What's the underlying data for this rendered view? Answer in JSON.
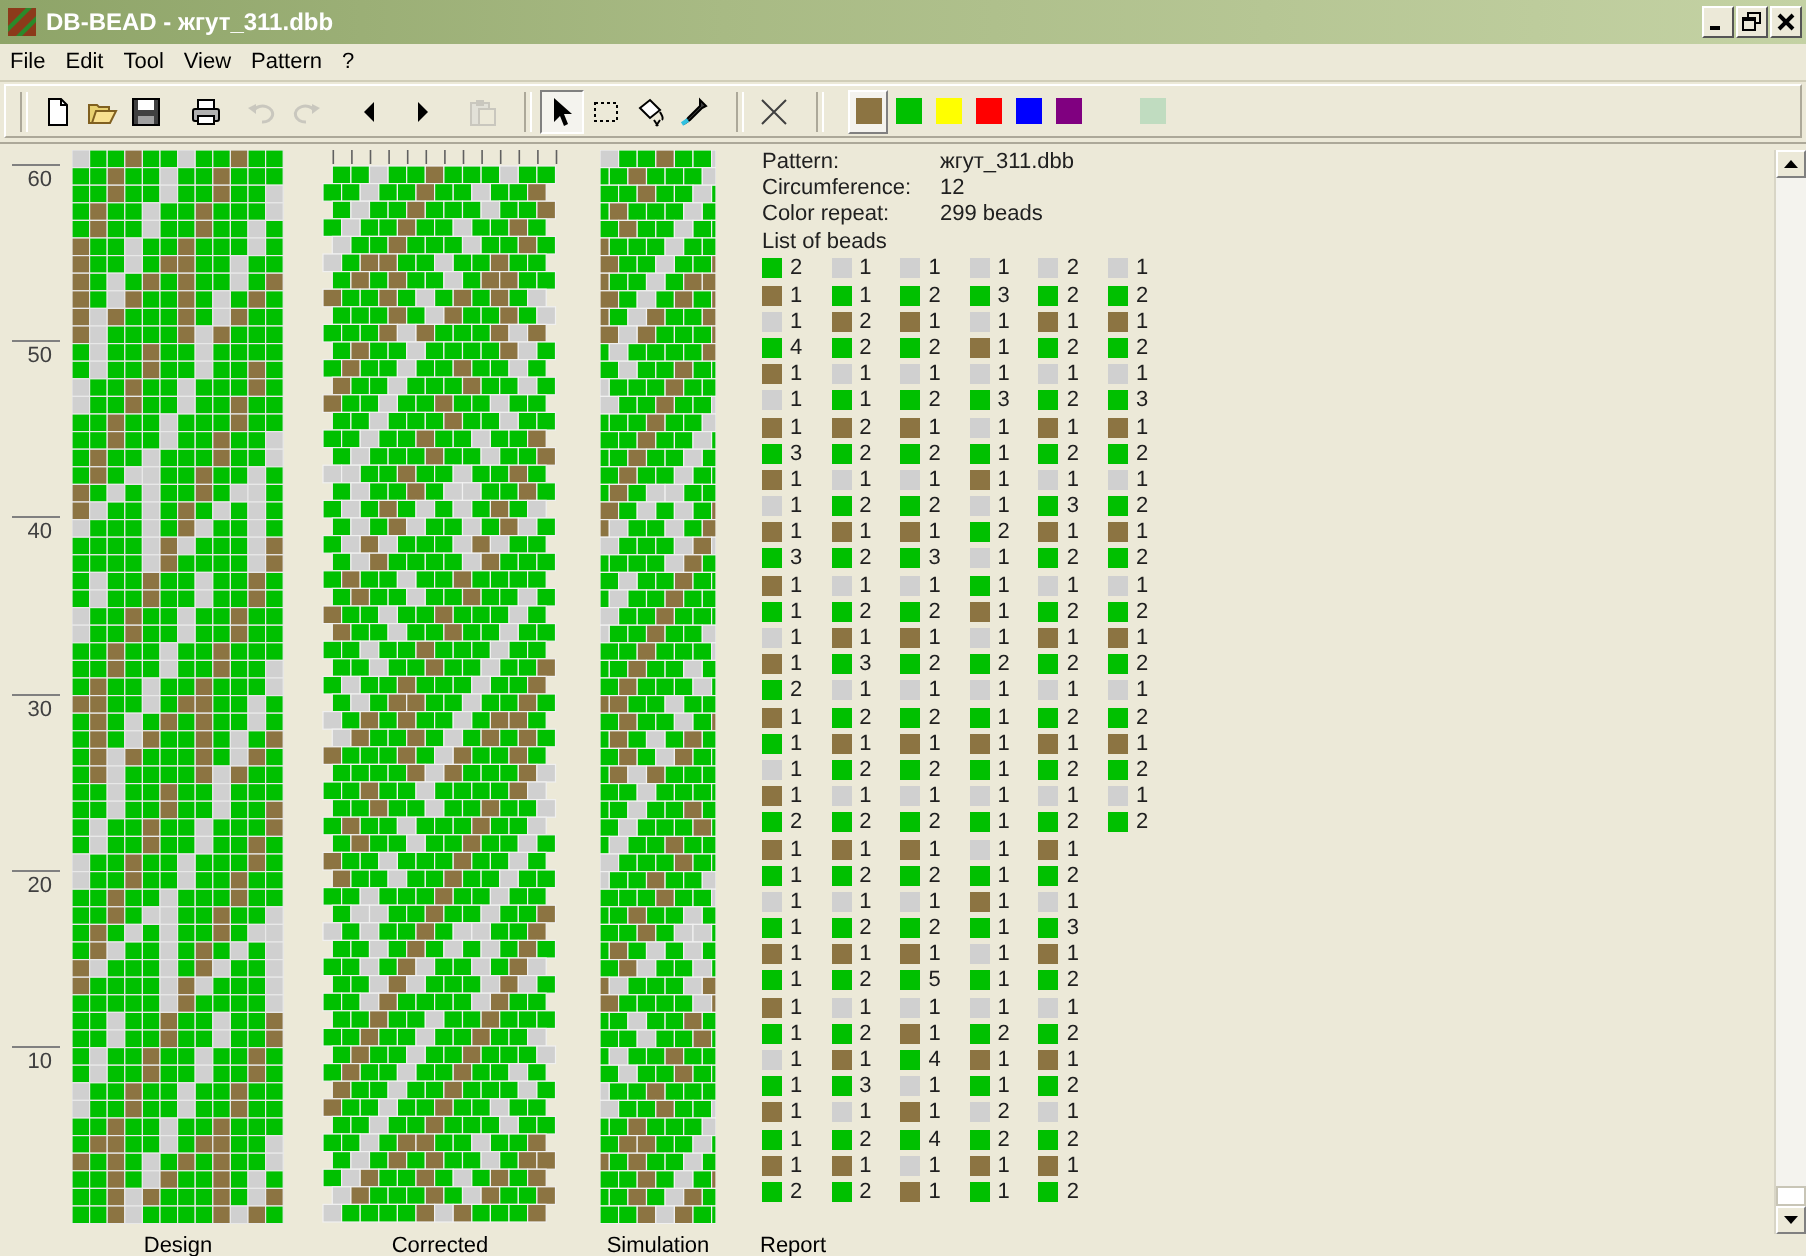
{
  "window": {
    "title": "DB-BEAD - жгут_311.dbb"
  },
  "menu": [
    "File",
    "Edit",
    "Tool",
    "View",
    "Pattern",
    "?"
  ],
  "toolbar": {
    "file_buttons": [
      {
        "kind": "new",
        "disabled": false
      },
      {
        "kind": "open",
        "disabled": false
      },
      {
        "kind": "save",
        "disabled": false
      },
      {
        "kind": "print",
        "disabled": false
      },
      {
        "kind": "undo",
        "disabled": true
      },
      {
        "kind": "redo",
        "disabled": true
      },
      {
        "kind": "prev",
        "disabled": false
      },
      {
        "kind": "next",
        "disabled": false
      },
      {
        "kind": "paste",
        "disabled": true
      }
    ],
    "tools": [
      {
        "kind": "pointer",
        "selected": true
      },
      {
        "kind": "rect",
        "selected": false
      },
      {
        "kind": "fill",
        "selected": false
      },
      {
        "kind": "dropper",
        "selected": false
      }
    ],
    "palette": [
      {
        "color": "#8c7442",
        "selected": true
      },
      {
        "color": "#00c000",
        "selected": false
      },
      {
        "color": "#ffff00",
        "selected": false
      },
      {
        "color": "#ff0000",
        "selected": false
      },
      {
        "color": "#0000ff",
        "selected": false
      },
      {
        "color": "#800080",
        "selected": false
      },
      {
        "color": "#c0dcc0",
        "selected": false
      }
    ]
  },
  "ruler": [
    "60",
    "50",
    "40",
    "30",
    "20",
    "10"
  ],
  "views": [
    "Design",
    "Corrected",
    "Simulation",
    "Report"
  ],
  "report": {
    "info": [
      {
        "label": "Pattern:",
        "value": "жгут_311.dbb"
      },
      {
        "label": "Circumference:",
        "value": "12"
      },
      {
        "label": "Color repeat:",
        "value": "299 beads"
      }
    ],
    "list_title": "List of beads",
    "bead_columns": [
      [
        {
          "color": "#00c000",
          "count": "2"
        },
        {
          "color": "#8c7442",
          "count": "1"
        },
        {
          "color": "#d0d0d0",
          "count": "1"
        },
        {
          "color": "#00c000",
          "count": "4"
        },
        {
          "color": "#8c7442",
          "count": "1"
        },
        {
          "color": "#d0d0d0",
          "count": "1"
        },
        {
          "color": "#8c7442",
          "count": "1"
        },
        {
          "color": "#00c000",
          "count": "3"
        },
        {
          "color": "#8c7442",
          "count": "1"
        },
        {
          "color": "#d0d0d0",
          "count": "1"
        },
        {
          "color": "#8c7442",
          "count": "1"
        },
        {
          "color": "#00c000",
          "count": "3"
        },
        {
          "color": "#8c7442",
          "count": "1"
        },
        {
          "color": "#00c000",
          "count": "1"
        },
        {
          "color": "#d0d0d0",
          "count": "1"
        },
        {
          "color": "#8c7442",
          "count": "1"
        },
        {
          "color": "#00c000",
          "count": "2"
        },
        {
          "color": "#8c7442",
          "count": "1"
        },
        {
          "color": "#00c000",
          "count": "1"
        },
        {
          "color": "#d0d0d0",
          "count": "1"
        },
        {
          "color": "#8c7442",
          "count": "1"
        },
        {
          "color": "#00c000",
          "count": "2"
        },
        {
          "color": "#8c7442",
          "count": "1"
        },
        {
          "color": "#00c000",
          "count": "1"
        },
        {
          "color": "#d0d0d0",
          "count": "1"
        },
        {
          "color": "#00c000",
          "count": "1"
        },
        {
          "color": "#8c7442",
          "count": "1"
        },
        {
          "color": "#00c000",
          "count": "1"
        },
        {
          "color": "#8c7442",
          "count": "1"
        },
        {
          "color": "#00c000",
          "count": "1"
        },
        {
          "color": "#d0d0d0",
          "count": "1"
        },
        {
          "color": "#00c000",
          "count": "1"
        },
        {
          "color": "#8c7442",
          "count": "1"
        },
        {
          "color": "#00c000",
          "count": "1"
        },
        {
          "color": "#8c7442",
          "count": "1"
        },
        {
          "color": "#00c000",
          "count": "2"
        }
      ],
      [
        {
          "color": "#d0d0d0",
          "count": "1"
        },
        {
          "color": "#00c000",
          "count": "1"
        },
        {
          "color": "#8c7442",
          "count": "2"
        },
        {
          "color": "#00c000",
          "count": "2"
        },
        {
          "color": "#d0d0d0",
          "count": "1"
        },
        {
          "color": "#00c000",
          "count": "1"
        },
        {
          "color": "#8c7442",
          "count": "2"
        },
        {
          "color": "#00c000",
          "count": "2"
        },
        {
          "color": "#d0d0d0",
          "count": "1"
        },
        {
          "color": "#00c000",
          "count": "2"
        },
        {
          "color": "#8c7442",
          "count": "1"
        },
        {
          "color": "#00c000",
          "count": "2"
        },
        {
          "color": "#d0d0d0",
          "count": "1"
        },
        {
          "color": "#00c000",
          "count": "2"
        },
        {
          "color": "#8c7442",
          "count": "1"
        },
        {
          "color": "#00c000",
          "count": "3"
        },
        {
          "color": "#d0d0d0",
          "count": "1"
        },
        {
          "color": "#00c000",
          "count": "2"
        },
        {
          "color": "#8c7442",
          "count": "1"
        },
        {
          "color": "#00c000",
          "count": "2"
        },
        {
          "color": "#d0d0d0",
          "count": "1"
        },
        {
          "color": "#00c000",
          "count": "2"
        },
        {
          "color": "#8c7442",
          "count": "1"
        },
        {
          "color": "#00c000",
          "count": "2"
        },
        {
          "color": "#d0d0d0",
          "count": "1"
        },
        {
          "color": "#00c000",
          "count": "2"
        },
        {
          "color": "#8c7442",
          "count": "1"
        },
        {
          "color": "#00c000",
          "count": "2"
        },
        {
          "color": "#d0d0d0",
          "count": "1"
        },
        {
          "color": "#00c000",
          "count": "2"
        },
        {
          "color": "#8c7442",
          "count": "1"
        },
        {
          "color": "#00c000",
          "count": "3"
        },
        {
          "color": "#d0d0d0",
          "count": "1"
        },
        {
          "color": "#00c000",
          "count": "2"
        },
        {
          "color": "#8c7442",
          "count": "1"
        },
        {
          "color": "#00c000",
          "count": "2"
        }
      ],
      [
        {
          "color": "#d0d0d0",
          "count": "1"
        },
        {
          "color": "#00c000",
          "count": "2"
        },
        {
          "color": "#8c7442",
          "count": "1"
        },
        {
          "color": "#00c000",
          "count": "2"
        },
        {
          "color": "#d0d0d0",
          "count": "1"
        },
        {
          "color": "#00c000",
          "count": "2"
        },
        {
          "color": "#8c7442",
          "count": "1"
        },
        {
          "color": "#00c000",
          "count": "2"
        },
        {
          "color": "#d0d0d0",
          "count": "1"
        },
        {
          "color": "#00c000",
          "count": "2"
        },
        {
          "color": "#8c7442",
          "count": "1"
        },
        {
          "color": "#00c000",
          "count": "3"
        },
        {
          "color": "#d0d0d0",
          "count": "1"
        },
        {
          "color": "#00c000",
          "count": "2"
        },
        {
          "color": "#8c7442",
          "count": "1"
        },
        {
          "color": "#00c000",
          "count": "2"
        },
        {
          "color": "#d0d0d0",
          "count": "1"
        },
        {
          "color": "#00c000",
          "count": "2"
        },
        {
          "color": "#8c7442",
          "count": "1"
        },
        {
          "color": "#00c000",
          "count": "2"
        },
        {
          "color": "#d0d0d0",
          "count": "1"
        },
        {
          "color": "#00c000",
          "count": "2"
        },
        {
          "color": "#8c7442",
          "count": "1"
        },
        {
          "color": "#00c000",
          "count": "2"
        },
        {
          "color": "#d0d0d0",
          "count": "1"
        },
        {
          "color": "#00c000",
          "count": "2"
        },
        {
          "color": "#8c7442",
          "count": "1"
        },
        {
          "color": "#00c000",
          "count": "5"
        },
        {
          "color": "#d0d0d0",
          "count": "1"
        },
        {
          "color": "#8c7442",
          "count": "1"
        },
        {
          "color": "#00c000",
          "count": "4"
        },
        {
          "color": "#d0d0d0",
          "count": "1"
        },
        {
          "color": "#8c7442",
          "count": "1"
        },
        {
          "color": "#00c000",
          "count": "4"
        },
        {
          "color": "#d0d0d0",
          "count": "1"
        },
        {
          "color": "#8c7442",
          "count": "1"
        }
      ],
      [
        {
          "color": "#d0d0d0",
          "count": "1"
        },
        {
          "color": "#00c000",
          "count": "3"
        },
        {
          "color": "#d0d0d0",
          "count": "1"
        },
        {
          "color": "#8c7442",
          "count": "1"
        },
        {
          "color": "#d0d0d0",
          "count": "1"
        },
        {
          "color": "#00c000",
          "count": "3"
        },
        {
          "color": "#d0d0d0",
          "count": "1"
        },
        {
          "color": "#00c000",
          "count": "1"
        },
        {
          "color": "#8c7442",
          "count": "1"
        },
        {
          "color": "#d0d0d0",
          "count": "1"
        },
        {
          "color": "#00c000",
          "count": "2"
        },
        {
          "color": "#d0d0d0",
          "count": "1"
        },
        {
          "color": "#00c000",
          "count": "1"
        },
        {
          "color": "#8c7442",
          "count": "1"
        },
        {
          "color": "#d0d0d0",
          "count": "1"
        },
        {
          "color": "#00c000",
          "count": "2"
        },
        {
          "color": "#d0d0d0",
          "count": "1"
        },
        {
          "color": "#00c000",
          "count": "1"
        },
        {
          "color": "#8c7442",
          "count": "1"
        },
        {
          "color": "#00c000",
          "count": "1"
        },
        {
          "color": "#d0d0d0",
          "count": "1"
        },
        {
          "color": "#00c000",
          "count": "1"
        },
        {
          "color": "#d0d0d0",
          "count": "1"
        },
        {
          "color": "#00c000",
          "count": "1"
        },
        {
          "color": "#8c7442",
          "count": "1"
        },
        {
          "color": "#00c000",
          "count": "1"
        },
        {
          "color": "#d0d0d0",
          "count": "1"
        },
        {
          "color": "#00c000",
          "count": "1"
        },
        {
          "color": "#d0d0d0",
          "count": "1"
        },
        {
          "color": "#00c000",
          "count": "2"
        },
        {
          "color": "#8c7442",
          "count": "1"
        },
        {
          "color": "#00c000",
          "count": "1"
        },
        {
          "color": "#d0d0d0",
          "count": "2"
        },
        {
          "color": "#00c000",
          "count": "2"
        },
        {
          "color": "#8c7442",
          "count": "1"
        },
        {
          "color": "#00c000",
          "count": "1"
        }
      ],
      [
        {
          "color": "#d0d0d0",
          "count": "2"
        },
        {
          "color": "#00c000",
          "count": "2"
        },
        {
          "color": "#8c7442",
          "count": "1"
        },
        {
          "color": "#00c000",
          "count": "2"
        },
        {
          "color": "#d0d0d0",
          "count": "1"
        },
        {
          "color": "#00c000",
          "count": "2"
        },
        {
          "color": "#8c7442",
          "count": "1"
        },
        {
          "color": "#00c000",
          "count": "2"
        },
        {
          "color": "#d0d0d0",
          "count": "1"
        },
        {
          "color": "#00c000",
          "count": "3"
        },
        {
          "color": "#8c7442",
          "count": "1"
        },
        {
          "color": "#00c000",
          "count": "2"
        },
        {
          "color": "#d0d0d0",
          "count": "1"
        },
        {
          "color": "#00c000",
          "count": "2"
        },
        {
          "color": "#8c7442",
          "count": "1"
        },
        {
          "color": "#00c000",
          "count": "2"
        },
        {
          "color": "#d0d0d0",
          "count": "1"
        },
        {
          "color": "#00c000",
          "count": "2"
        },
        {
          "color": "#8c7442",
          "count": "1"
        },
        {
          "color": "#00c000",
          "count": "2"
        },
        {
          "color": "#d0d0d0",
          "count": "1"
        },
        {
          "color": "#00c000",
          "count": "2"
        },
        {
          "color": "#8c7442",
          "count": "1"
        },
        {
          "color": "#00c000",
          "count": "2"
        },
        {
          "color": "#d0d0d0",
          "count": "1"
        },
        {
          "color": "#00c000",
          "count": "3"
        },
        {
          "color": "#8c7442",
          "count": "1"
        },
        {
          "color": "#00c000",
          "count": "2"
        },
        {
          "color": "#d0d0d0",
          "count": "1"
        },
        {
          "color": "#00c000",
          "count": "2"
        },
        {
          "color": "#8c7442",
          "count": "1"
        },
        {
          "color": "#00c000",
          "count": "2"
        },
        {
          "color": "#d0d0d0",
          "count": "1"
        },
        {
          "color": "#00c000",
          "count": "2"
        },
        {
          "color": "#8c7442",
          "count": "1"
        },
        {
          "color": "#00c000",
          "count": "2"
        }
      ],
      [
        {
          "color": "#d0d0d0",
          "count": "1"
        },
        {
          "color": "#00c000",
          "count": "2"
        },
        {
          "color": "#8c7442",
          "count": "1"
        },
        {
          "color": "#00c000",
          "count": "2"
        },
        {
          "color": "#d0d0d0",
          "count": "1"
        },
        {
          "color": "#00c000",
          "count": "3"
        },
        {
          "color": "#8c7442",
          "count": "1"
        },
        {
          "color": "#00c000",
          "count": "2"
        },
        {
          "color": "#d0d0d0",
          "count": "1"
        },
        {
          "color": "#00c000",
          "count": "2"
        },
        {
          "color": "#8c7442",
          "count": "1"
        },
        {
          "color": "#00c000",
          "count": "2"
        },
        {
          "color": "#d0d0d0",
          "count": "1"
        },
        {
          "color": "#00c000",
          "count": "2"
        },
        {
          "color": "#8c7442",
          "count": "1"
        },
        {
          "color": "#00c000",
          "count": "2"
        },
        {
          "color": "#d0d0d0",
          "count": "1"
        },
        {
          "color": "#00c000",
          "count": "2"
        },
        {
          "color": "#8c7442",
          "count": "1"
        },
        {
          "color": "#00c000",
          "count": "2"
        },
        {
          "color": "#d0d0d0",
          "count": "1"
        },
        {
          "color": "#00c000",
          "count": "2"
        }
      ]
    ]
  }
}
